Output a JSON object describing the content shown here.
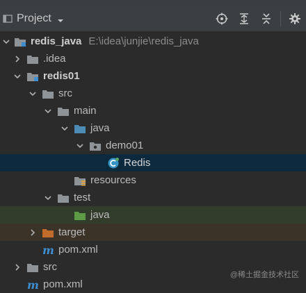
{
  "header": {
    "title": "Project",
    "tools": [
      "locate-icon",
      "expand-all-icon",
      "collapse-all-icon",
      "settings-icon"
    ]
  },
  "tree": [
    {
      "name": "redis_java",
      "path": "E:\\idea\\junjie\\redis_java",
      "icon": "module-folder",
      "expanded": true,
      "bold": true
    },
    {
      "name": ".idea",
      "icon": "folder",
      "expanded": false
    },
    {
      "name": "redis01",
      "icon": "module-folder",
      "expanded": true,
      "bold": true
    },
    {
      "name": "src",
      "icon": "folder",
      "expanded": true
    },
    {
      "name": "main",
      "icon": "folder",
      "expanded": true
    },
    {
      "name": "java",
      "icon": "source-folder",
      "expanded": true
    },
    {
      "name": "demo01",
      "icon": "package-folder",
      "expanded": true
    },
    {
      "name": "Redis",
      "icon": "java-class",
      "selected": true
    },
    {
      "name": "resources",
      "icon": "resources-folder"
    },
    {
      "name": "test",
      "icon": "folder",
      "expanded": true
    },
    {
      "name": "java",
      "icon": "test-source-folder"
    },
    {
      "name": "target",
      "icon": "excluded-folder",
      "expanded": false
    },
    {
      "name": "pom.xml",
      "icon": "maven-file"
    },
    {
      "name": "src",
      "icon": "folder",
      "expanded": false
    },
    {
      "name": "pom.xml",
      "icon": "maven-file"
    }
  ],
  "watermark": "@稀土掘金技术社区",
  "colors": {
    "background": "#2b2b2b",
    "toolbar": "#3c3f41",
    "selection": "#0d293e",
    "test_row": "#313c2b",
    "excluded_row": "#3b3328",
    "folder": "#8d9396",
    "source_folder": "#4c8bb4",
    "test_folder": "#5d9b47",
    "excluded_folder": "#c36a2d",
    "maven": "#3d8fd1"
  }
}
